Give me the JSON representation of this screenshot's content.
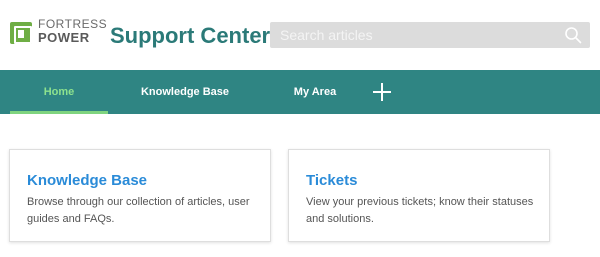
{
  "header": {
    "logo_top": "FORTRESS",
    "logo_bottom": "POWER",
    "title": "Support Center",
    "search_placeholder": "Search articles"
  },
  "nav": {
    "items": [
      {
        "label": "Home",
        "active": true
      },
      {
        "label": "Knowledge Base",
        "active": false
      },
      {
        "label": "My Area",
        "active": false
      }
    ]
  },
  "cards": [
    {
      "title": "Knowledge Base",
      "description": "Browse through our collection of articles, user guides and FAQs."
    },
    {
      "title": "Tickets",
      "description": "View your previous tickets; know their statuses and solutions."
    }
  ],
  "colors": {
    "nav_bg": "#2f8583",
    "title_teal": "#2b7a78",
    "active_green": "#8ee28e",
    "link_blue": "#2a8bd8",
    "logo_green": "#6fae45"
  },
  "icons": {
    "search": "search-icon",
    "add": "plus-icon"
  }
}
